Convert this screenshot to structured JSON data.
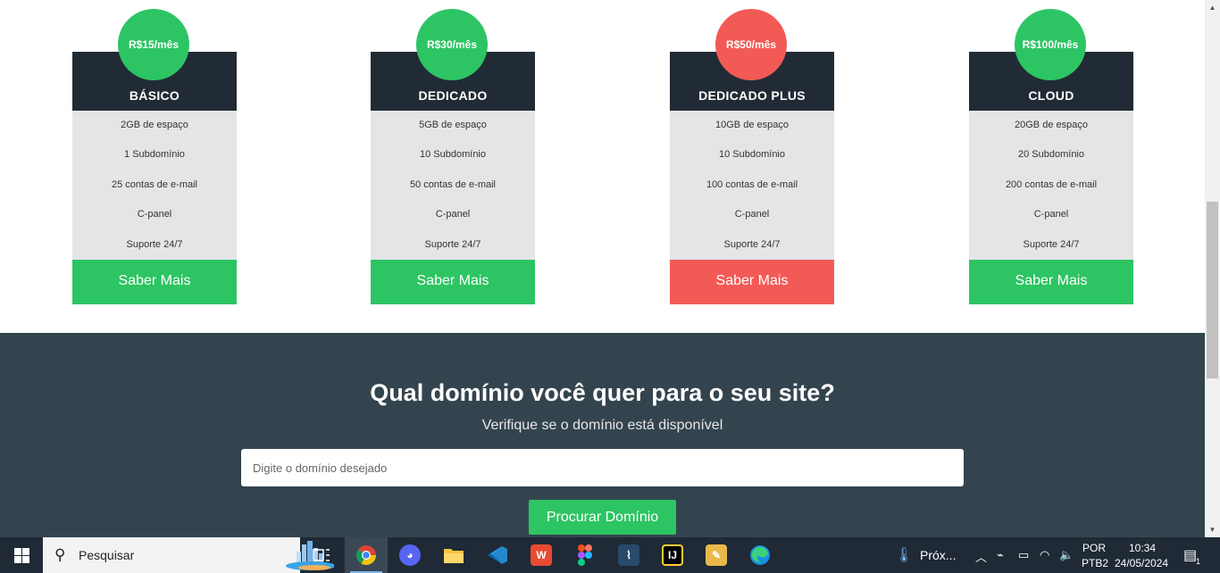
{
  "plans": [
    {
      "price": "R$15/mês",
      "name": "BÁSICO",
      "features": [
        "2GB de espaço",
        "1 Subdomínio",
        "25 contas de e-mail",
        "C-panel",
        "Suporte 24/7"
      ],
      "button": "Saber Mais"
    },
    {
      "price": "R$30/mês",
      "name": "DEDICADO",
      "features": [
        "5GB de espaço",
        "10 Subdomínio",
        "50 contas de e-mail",
        "C-panel",
        "Suporte 24/7"
      ],
      "button": "Saber Mais"
    },
    {
      "price": "R$50/mês",
      "name": "DEDICADO PLUS",
      "features": [
        "10GB de espaço",
        "10 Subdomínio",
        "100 contas de e-mail",
        "C-panel",
        "Suporte 24/7"
      ],
      "button": "Saber Mais"
    },
    {
      "price": "R$100/mês",
      "name": "CLOUD",
      "features": [
        "20GB de espaço",
        "20 Subdomínio",
        "200 contas de e-mail",
        "C-panel",
        "Suporte 24/7"
      ],
      "button": "Saber Mais"
    }
  ],
  "domain": {
    "title": "Qual domínio você quer para o seu site?",
    "subtitle": "Verifique se o domínio está disponível",
    "placeholder": "Digite o domínio desejado",
    "button": "Procurar Domínio"
  },
  "taskbar": {
    "search_text": "Pesquisar",
    "weather_text": "Próx...",
    "lang_top": "POR",
    "lang_bottom": "PTB2",
    "time": "10:34",
    "date": "24/05/2024",
    "notification_count": "1"
  },
  "colors": {
    "green": "#2dc463",
    "red": "#f25a56",
    "dark": "#212b35",
    "section": "#34444e"
  }
}
